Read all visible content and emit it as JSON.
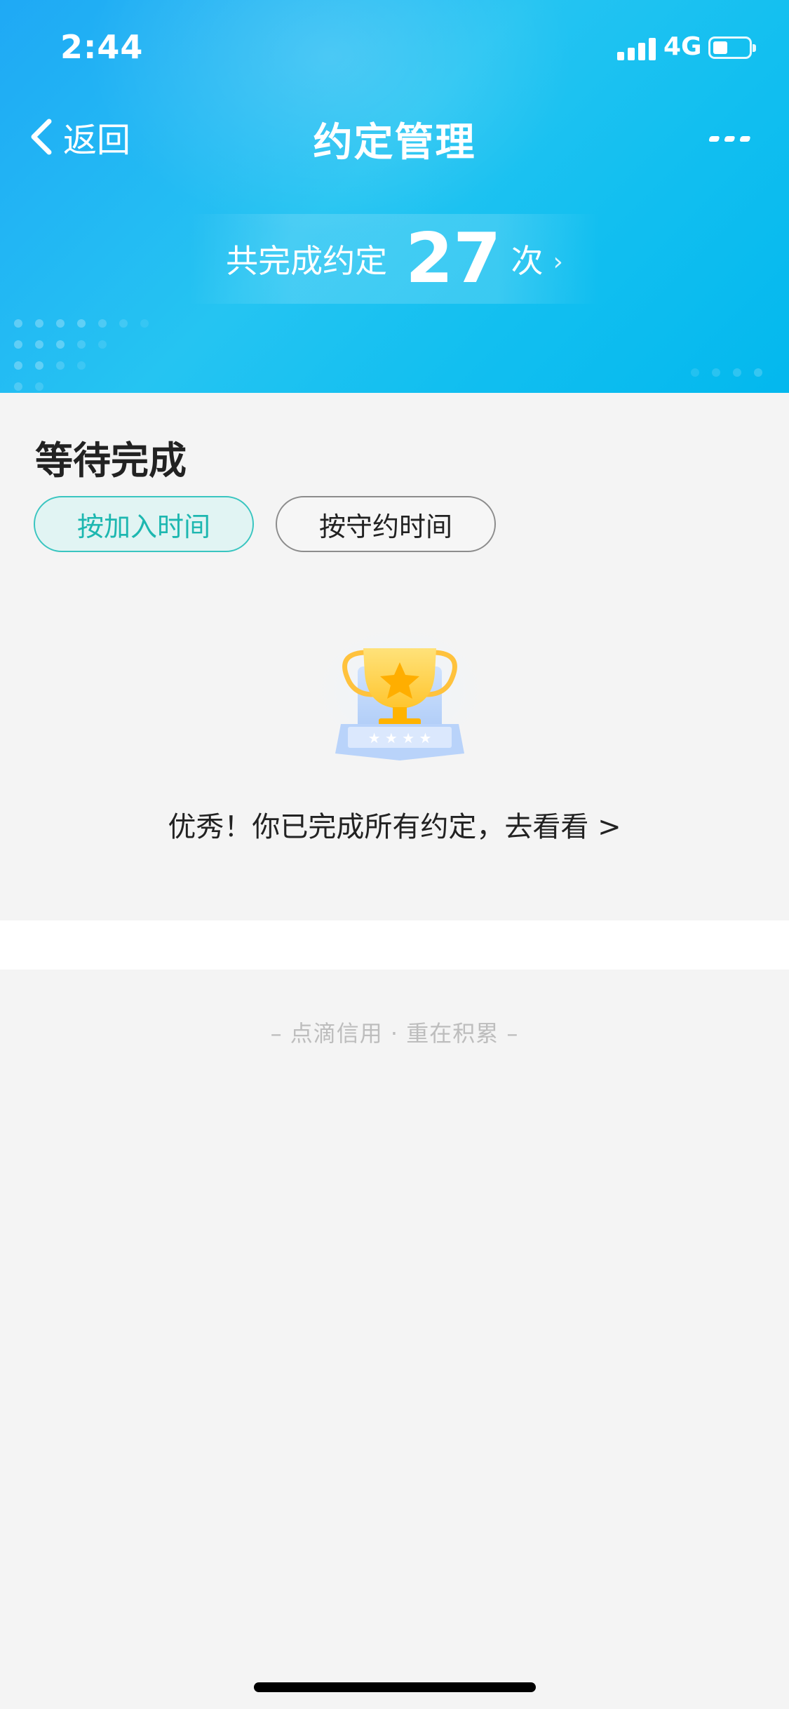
{
  "status_bar": {
    "time": "2:44",
    "network": "4G"
  },
  "nav": {
    "back_label": "返回",
    "title": "约定管理"
  },
  "summary": {
    "prefix": "共完成约定",
    "count": "27",
    "suffix": "次",
    "arrow": "›"
  },
  "pending": {
    "title": "等待完成",
    "sort_tabs": [
      {
        "label": "按加入时间",
        "active": true
      },
      {
        "label": "按守约时间",
        "active": false
      }
    ],
    "empty_message": "优秀！你已完成所有约定，去看看 >"
  },
  "footer": {
    "slogan": "– 点滴信用 · 重在积累 –"
  },
  "colors": {
    "header_start": "#1fa9f5",
    "header_end": "#03b8ee",
    "accent": "#1db7b0"
  }
}
